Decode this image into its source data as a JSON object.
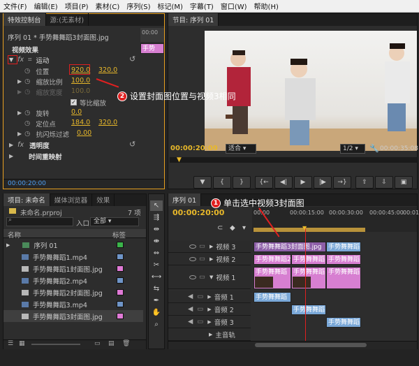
{
  "menu": [
    "文件(F)",
    "编辑(E)",
    "项目(P)",
    "素材(C)",
    "序列(S)",
    "标记(M)",
    "字幕(T)",
    "窗口(W)",
    "帮助(H)"
  ],
  "effect_controls": {
    "tabs": [
      "特效控制台",
      "源:(无素材)"
    ],
    "clip_name": "序列 01 * 手势舞舞蹈3封面图.jpg",
    "mini_clip": "手势",
    "section": "视频效果",
    "motion": "运动",
    "position_label": "位置",
    "position_x": "920.0",
    "position_y": "320.0",
    "scale_label": "缩放比例",
    "scale_value": "100.0",
    "scale_width_label": "缩放宽度",
    "scale_width_value": "100.0",
    "uniform_scale": "等比缩放",
    "rotation_label": "旋转",
    "rotation_value": "0.0",
    "anchor_label": "定位点",
    "anchor_x": "184.0",
    "anchor_y": "320.0",
    "antiflicker_label": "抗闪烁过滤",
    "antiflicker_value": "0.00",
    "opacity": "透明度",
    "time_remap": "时间重映射",
    "timecode": "00:00:20:00"
  },
  "program": {
    "title": "节目: 序列 01",
    "timecode": "00:00:20:00",
    "fit": "适合",
    "resolution": "1/2",
    "duration": "00:00:35:08"
  },
  "project": {
    "tabs": [
      "项目: 未命名",
      "媒体浏览器",
      "效果"
    ],
    "file": "未命名.prproj",
    "count": "7 项",
    "search_placeholder": "",
    "in_label": "入口:",
    "in_value": "全部",
    "col_name": "名称",
    "col_label": "标签",
    "items": [
      {
        "name": "序列 01",
        "color": "#3bb44a"
      },
      {
        "name": "手势舞舞蹈1.mp4",
        "color": "#6f95c8"
      },
      {
        "name": "手势舞舞蹈1封面图.jpg",
        "color": "#e07ad6"
      },
      {
        "name": "手势舞舞蹈2.mp4",
        "color": "#6f95c8"
      },
      {
        "name": "手势舞舞蹈2封面图.jpg",
        "color": "#e07ad6"
      },
      {
        "name": "手势舞舞蹈3.mp4",
        "color": "#6f95c8"
      },
      {
        "name": "手势舞舞蹈3封面图.jpg",
        "color": "#e07ad6"
      }
    ]
  },
  "timeline": {
    "tab": "序列 01",
    "timecode": "00:00:20:00",
    "ruler": [
      "00:00",
      "00:00:15:00",
      "00:00:30:00",
      "00:00:45:00",
      "00:01:0"
    ],
    "tracks": {
      "v3": "视频 3",
      "v2": "视频 2",
      "v1": "视频 1",
      "a1": "音频 1",
      "a2": "音频 2",
      "a3": "音频 3",
      "master": "主音轨"
    },
    "clip_v3a": "手势舞舞蹈3封面图.jpg",
    "clip_v3b": "手势舞舞蹈",
    "clip_v2a": "手势舞舞蹈2",
    "clip_v2b": "手势舞舞蹈",
    "clip_v2c": "手势舞舞蹈",
    "clip_v1a": "手势舞舞蹈",
    "clip_v1b": "手势舞舞蹈",
    "clip_v1c": "手势舞舞蹈",
    "clip_a1": "手势舞舞蹈",
    "clip_a2": "手势舞舞蹈",
    "clip_a3": "手势舞舞蹈"
  },
  "annotations": {
    "a1_num": "1",
    "a1_text": "单击选中视频3封面图",
    "a2_num": "2",
    "a2_text": "设置封面图位置与视频3相同"
  }
}
